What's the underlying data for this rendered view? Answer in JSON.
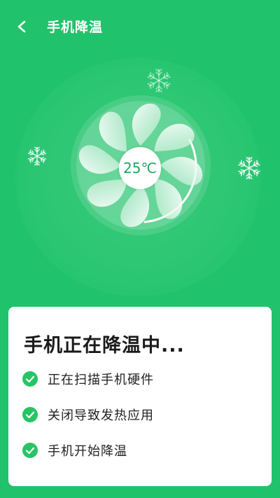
{
  "header": {
    "title": "手机降温",
    "back_icon": "chevron-left-icon"
  },
  "fan": {
    "temperature": "25℃",
    "icon": "fan-icon"
  },
  "decorations": {
    "snow_icon": "snowflake-icon"
  },
  "status_card": {
    "title": "手机正在降温中...",
    "steps": [
      {
        "label": "正在扫描手机硬件",
        "done": true
      },
      {
        "label": "关闭导致发热应用",
        "done": true
      },
      {
        "label": "手机开始降温",
        "done": true
      }
    ]
  },
  "colors": {
    "background": "#20c36b",
    "accent": "#22a65e",
    "check": "#27c465"
  }
}
